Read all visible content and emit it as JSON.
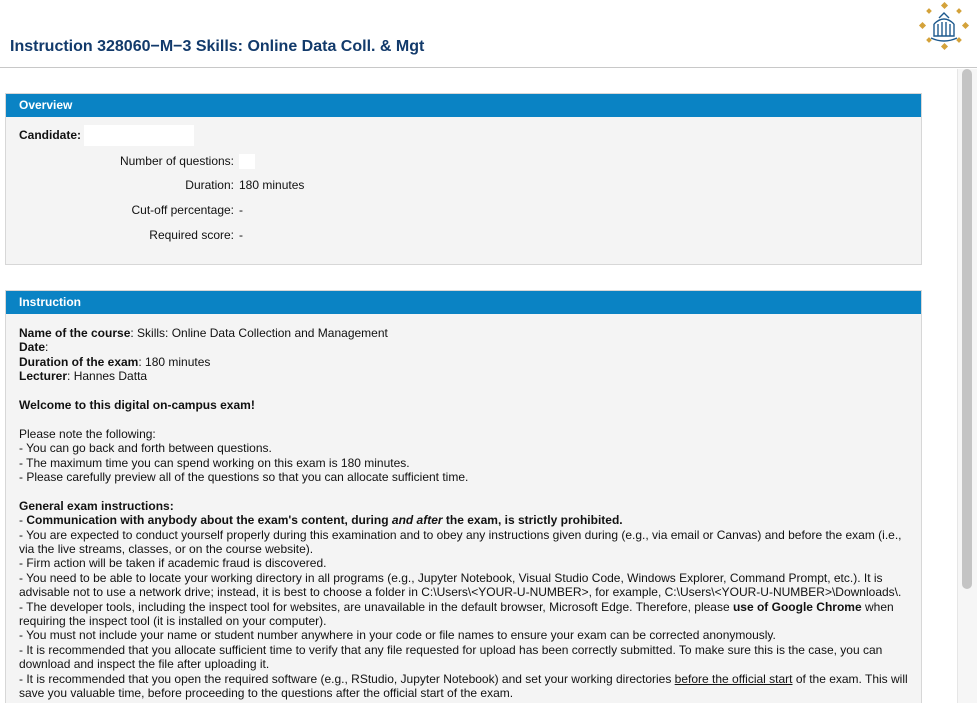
{
  "header": {
    "title": "Instruction 328060−M−3 Skills: Online Data Coll. & Mgt"
  },
  "overview": {
    "heading": "Overview",
    "candidate_label": "Candidate:",
    "rows": [
      {
        "label": "Number of questions:",
        "value": ""
      },
      {
        "label": "Duration:",
        "value": "180 minutes"
      },
      {
        "label": "Cut-off percentage:",
        "value": "-"
      },
      {
        "label": "Required score:",
        "value": "-"
      }
    ]
  },
  "instruction": {
    "heading": "Instruction",
    "course_label": "Name of the course",
    "course_value": ": Skills: Online Data Collection and Management",
    "date_label": "Date",
    "date_value": ":",
    "duration_label": "Duration of the exam",
    "duration_value": ": 180 minutes",
    "lecturer_label": "Lecturer",
    "lecturer_value": ": Hannes Datta",
    "welcome": "Welcome to this digital on-campus exam!",
    "note_intro": "Please note the following:",
    "notes": [
      "- You can go back and forth between questions.",
      "- The maximum time you can spend working on this exam is 180 minutes.",
      "- Please carefully preview all of the questions so that you can allocate sufficient time."
    ],
    "general_heading": "General exam instructions:",
    "comm_prefix": "- ",
    "comm_bold_a": "Communication with anybody about the exam's content, during ",
    "comm_italic": "and after",
    "comm_bold_b": " the exam, is strictly prohibited.",
    "rule_conduct": "- You are expected to conduct yourself properly during this examination and to obey any instructions given during (e.g., via email or Canvas) and before the exam (i.e., via the live streams, classes, or on the course website).",
    "rule_fraud": "- Firm action will be taken if academic fraud is discovered.",
    "rule_directory": "- You need to be able to locate your working directory in all programs (e.g., Jupyter Notebook, Visual Studio Code, Windows Explorer, Command Prompt, etc.). It is advisable not to use a network drive; instead, it is best to choose a folder in C:\\Users\\<YOUR-U-NUMBER>, for example, C:\\Users\\<YOUR-U-NUMBER>\\Downloads\\.",
    "rule_devtools_a": "- The developer tools, including the inspect tool for websites, are unavailable in the default browser, Microsoft Edge. Therefore, please ",
    "rule_devtools_bold": "use of Google Chrome",
    "rule_devtools_b": " when requiring the inspect tool (it is installed on your computer).",
    "rule_name": "- You must not include your name or student number anywhere in your code or file names to ensure your exam can be corrected anonymously.",
    "rule_upload": "- It is recommended that you allocate sufficient time to verify that any file requested for upload has been correctly submitted. To make sure this is the case, you can download and inspect the file after uploading it.",
    "rule_software_a": "- It is recommended that you open the required software (e.g., RStudio, Jupyter Notebook) and set your working directories ",
    "rule_software_u": "before the official start",
    "rule_software_b": " of the exam. This will save you valuable time, before proceeding to the questions after the official start of the exam."
  },
  "colors": {
    "title": "#123a6b",
    "panel_header": "#0a83c4",
    "panel_body": "#f4f4f4",
    "logo_gold": "#d4a23a",
    "logo_blue": "#1e5a8e"
  },
  "icons": {
    "logo": "university-seal-icon"
  }
}
